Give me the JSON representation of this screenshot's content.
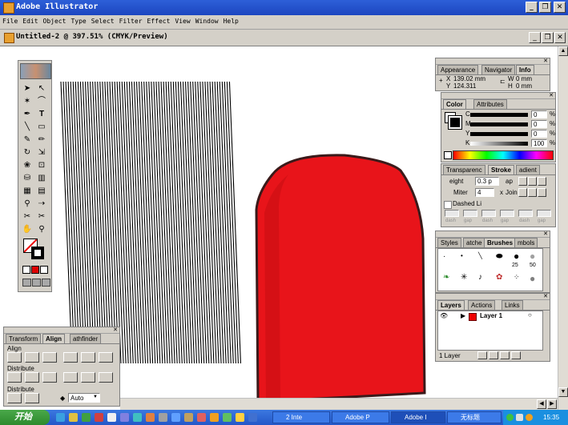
{
  "app": {
    "title": "Adobe Illustrator"
  },
  "window_buttons": [
    "_",
    "❐",
    "✕"
  ],
  "menu": [
    "File",
    "Edit",
    "Object",
    "Type",
    "Select",
    "Filter",
    "Effect",
    "View",
    "Window",
    "Help"
  ],
  "document": {
    "title": "Untitled-2 @ 397.51% (CMYK/Preview)"
  },
  "info_palette": {
    "tabs": [
      "Appearance",
      "Navigator",
      "Info"
    ],
    "x_label": "X",
    "x_value": "139.02 mm",
    "y_label": "Y",
    "y_value": "124.311",
    "w_label": "W",
    "w_value": "0 mm",
    "h_label": "H",
    "h_value": "0 mm"
  },
  "color_palette": {
    "tabs": [
      "Color",
      "Attributes"
    ],
    "channels": [
      {
        "label": "C",
        "value": "0",
        "unit": "%"
      },
      {
        "label": "M",
        "value": "0",
        "unit": "%"
      },
      {
        "label": "Y",
        "value": "0",
        "unit": "%"
      },
      {
        "label": "K",
        "value": "100",
        "unit": "%"
      }
    ]
  },
  "stroke_palette": {
    "tabs": [
      "Transparenc",
      "Stroke",
      "adient"
    ],
    "weight_label": "eight",
    "weight_value": "0.3 p",
    "cap_label": "ap",
    "miter_label": "Miter",
    "miter_value": "4",
    "miter_unit": "x",
    "join_label": "Join",
    "dashed_label": "Dashed Li",
    "dash_fields": [
      "dash",
      "gap",
      "dash",
      "gap",
      "dash",
      "gap"
    ]
  },
  "brushes_palette": {
    "tabs": [
      "Styles",
      "atche",
      "Brushes",
      "mbols"
    ],
    "size_labels": [
      "25",
      "50"
    ]
  },
  "layers_palette": {
    "tabs": [
      "Layers",
      "Actions",
      "Links"
    ],
    "layer_name": "Layer 1",
    "footer": "1 Layer"
  },
  "align_palette": {
    "tabs": [
      "Transform",
      "Align",
      "athfinder"
    ],
    "align_label": "Align",
    "distribute_label": "Distribute",
    "distribute_spacing_label": "Distribute",
    "spacing_value": "Auto"
  },
  "taskbar": {
    "start_label": "开始",
    "tasks": [
      "2 Inte",
      "Adobe P",
      "Adobe I",
      "无标题"
    ],
    "clock": "15:35"
  },
  "colors": {
    "shape_fill": "#e8141a",
    "shape_stroke": "#3a1a1a",
    "titlebar": "#2350cc"
  }
}
